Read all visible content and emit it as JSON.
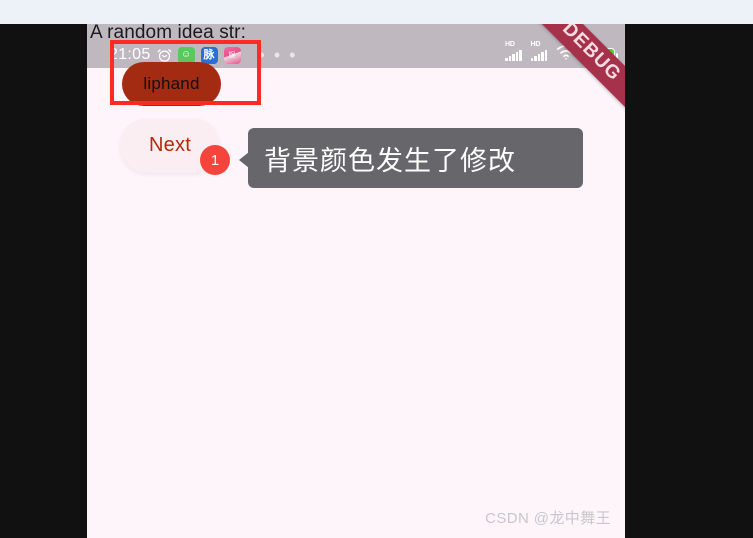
{
  "window": {
    "background_color": "#111111",
    "top_strip_color": "#edf1f8"
  },
  "phone": {
    "screen_background": "#fdf5fa",
    "header": {
      "title": "A random idea str:",
      "background_color": "#bfb9bf"
    },
    "status_bar": {
      "time": "21:05",
      "alarm_icon": "alarm-clock-icon",
      "app_icons": [
        {
          "name": "green-app-icon",
          "glyph": "☺",
          "color": "#5ac85a"
        },
        {
          "name": "maimai-app-icon",
          "glyph": "脉",
          "color": "#2a6fd6"
        },
        {
          "name": "pink-app-icon",
          "glyph": "娱",
          "color": "#ef4f86"
        }
      ],
      "overflow": "• • •",
      "signal_1_label": "HD",
      "signal_2_label": "HD",
      "wifi_icon": "wifi-icon",
      "battery_level": "93",
      "battery_color": "#58d13a"
    },
    "debug_ribbon": {
      "label": "DEBUG",
      "color": "#a5314a"
    },
    "highlight_box": {
      "border_color": "#ff2a24"
    },
    "liphand_pill": {
      "label": "liphand",
      "background_color": "#a32b12",
      "text_color": "#111111"
    },
    "next_button": {
      "label": "Next",
      "background_color": "#fbeef3",
      "text_color": "#b12b0c",
      "badge_count": "1",
      "badge_color": "#f5443c"
    },
    "tooltip": {
      "message": "背景颜色发生了修改",
      "background_color": "#67666b",
      "text_color": "#ffffff"
    },
    "watermark": "CSDN @龙中舞王"
  }
}
